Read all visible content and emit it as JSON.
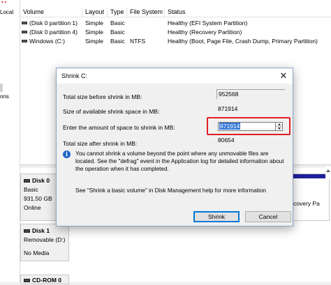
{
  "left_strip": {
    "local_label": "Local",
    "ons_label": "ons"
  },
  "volume_list": {
    "columns": [
      "Volume",
      "Layout",
      "Type",
      "File System",
      "Status"
    ],
    "rows": [
      {
        "volume": "(Disk 0 partition 1)",
        "layout": "Simple",
        "type": "Basic",
        "fs": "",
        "status": "Healthy (EFI System Partition)"
      },
      {
        "volume": "(Disk 0 partition 4)",
        "layout": "Simple",
        "type": "Basic",
        "fs": "",
        "status": "Healthy (Recovery Partition)"
      },
      {
        "volume": "Windows (C:)",
        "layout": "Simple",
        "type": "Basic",
        "fs": "NTFS",
        "status": "Healthy (Boot, Page File, Crash Dump, Primary Partition)"
      }
    ]
  },
  "disks": [
    {
      "name": "Disk 0",
      "type": "Basic",
      "size": "931.50 GB",
      "state": "Online"
    },
    {
      "name": "Disk 1",
      "type": "Removable (D:)",
      "size": "",
      "state": "No Media"
    },
    {
      "name": "CD-ROM 0",
      "type": "",
      "size": "",
      "state": ""
    }
  ],
  "partition_fragment": "covery Pa",
  "dialog": {
    "title": "Shrink C:",
    "total_size_label": "Total size before shrink in MB:",
    "total_size_value": "952568",
    "available_label": "Size of available shrink space in MB:",
    "available_value": "871914",
    "amount_label": "Enter the amount of space to shrink in MB:",
    "amount_value": "871914",
    "after_label": "Total size after shrink in MB:",
    "after_value": "80654",
    "info_text": "You cannot shrink a volume beyond the point where any unmovable files are located. See the \"defrag\" event in the Application log for detailed information about the operation when it has completed.",
    "help_text": "See \"Shrink a basic volume\" in Disk Management help for more information",
    "shrink_button": "Shrink",
    "cancel_button": "Cancel"
  },
  "colors": {
    "highlight_border": "#e01e24",
    "selection": "#3478d6",
    "partition_bar": "#1f1f99",
    "info_icon": "#1e66c8"
  }
}
